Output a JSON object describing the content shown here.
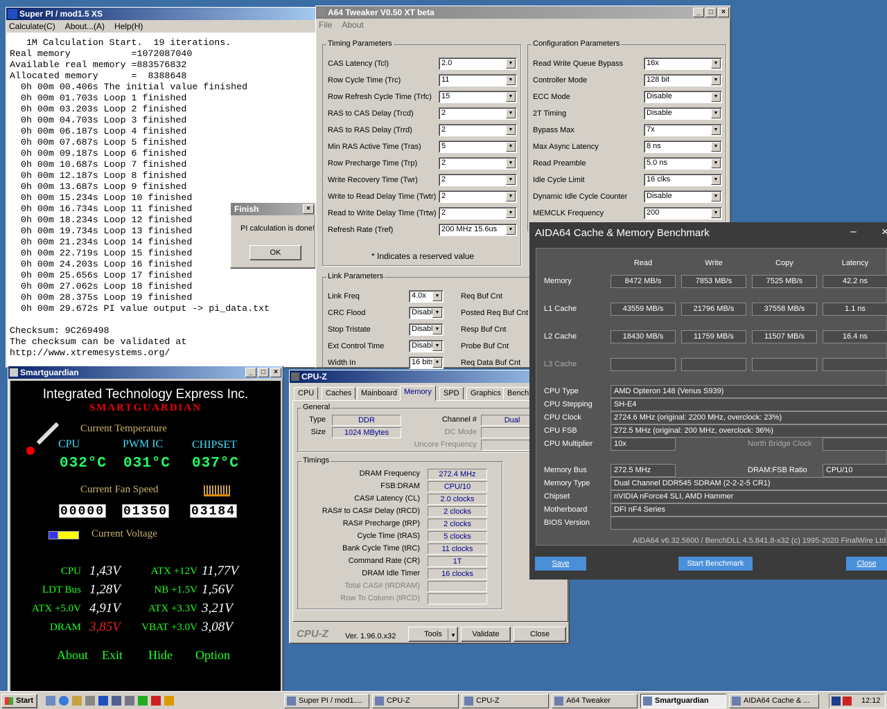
{
  "superpi": {
    "title": "Super PI / mod1.5 XS",
    "menu": [
      "Calculate(C)",
      "About...(A)",
      "Help(H)"
    ],
    "log": "   1M Calculation Start.  19 iterations.\nReal memory           =1072087040\nAvailable real memory =883576832\nAllocated memory      =  8388648\n  0h 00m 00.406s The initial value finished\n  0h 00m 01.703s Loop 1 finished\n  0h 00m 03.203s Loop 2 finished\n  0h 00m 04.703s Loop 3 finished\n  0h 00m 06.187s Loop 4 finished\n  0h 00m 07.687s Loop 5 finished\n  0h 00m 09.187s Loop 6 finished\n  0h 00m 10.687s Loop 7 finished\n  0h 00m 12.187s Loop 8 finished\n  0h 00m 13.687s Loop 9 finished\n  0h 00m 15.234s Loop 10 finished\n  0h 00m 16.734s Loop 11 finished\n  0h 00m 18.234s Loop 12 finished\n  0h 00m 19.734s Loop 13 finished\n  0h 00m 21.234s Loop 14 finished\n  0h 00m 22.719s Loop 15 finished\n  0h 00m 24.203s Loop 16 finished\n  0h 00m 25.656s Loop 17 finished\n  0h 00m 27.062s Loop 18 finished\n  0h 00m 28.375s Loop 19 finished\n  0h 00m 29.672s PI value output -> pi_data.txt\n\nChecksum: 9C269498\nThe checksum can be validated at\nhttp://www.xtremesystems.org/"
  },
  "finish": {
    "title": "Finish",
    "message": "PI calculation is done!",
    "ok": "OK"
  },
  "a64": {
    "title": "A64 Tweaker V0.50 XT beta",
    "menu": [
      "File",
      "About"
    ],
    "timing_title": "Timing Parameters",
    "timing": [
      {
        "label": "CAS Latency (Tcl)",
        "value": "2.0"
      },
      {
        "label": "Row Cycle Time (Trc)",
        "value": "11"
      },
      {
        "label": "Row Refresh Cycle Time (Trfc)",
        "value": "15"
      },
      {
        "label": "RAS to CAS Delay (Trcd)",
        "value": "2"
      },
      {
        "label": "RAS to RAS Delay (Trrd)",
        "value": "2"
      },
      {
        "label": "Min RAS Active Time (Tras)",
        "value": "5"
      },
      {
        "label": "Row Precharge Time (Trp)",
        "value": "2"
      },
      {
        "label": "Write Recovery Time (Twr)",
        "value": "2"
      },
      {
        "label": "Write to Read Delay Time (Twtr)",
        "value": "2"
      },
      {
        "label": "Read to Write Delay Time (Trtw)",
        "value": "2"
      },
      {
        "label": "Refresh Rate (Tref)",
        "value": "200 MHz 15.6us"
      }
    ],
    "reserved_note": "* Indicates a reserved value",
    "config_title": "Configuration Parameters",
    "config": [
      {
        "label": "Read Write Queue Bypass",
        "value": "16x"
      },
      {
        "label": "Controller Mode",
        "value": "128 bit"
      },
      {
        "label": "ECC Mode",
        "value": "Disable"
      },
      {
        "label": "2T Timing",
        "value": "Disable"
      },
      {
        "label": "Bypass Max",
        "value": "7x"
      },
      {
        "label": "Max Async Latency",
        "value": "8 ns"
      },
      {
        "label": "Read Preamble",
        "value": "5.0 ns"
      },
      {
        "label": "Idle Cycle Limit",
        "value": "16 clks"
      },
      {
        "label": "Dynamic Idle Cycle Counter",
        "value": "Disable"
      },
      {
        "label": "MEMCLK Frequency",
        "value": "200"
      }
    ],
    "link_title": "Link Parameters",
    "link": [
      {
        "label": "Link Freq",
        "value": "4.0x"
      },
      {
        "label": "CRC Flood",
        "value": "Disable"
      },
      {
        "label": "Stop Tristate",
        "value": "Disable"
      },
      {
        "label": "Ext Control Time",
        "value": "Disable"
      },
      {
        "label": "Width In",
        "value": "16 bits"
      }
    ],
    "buf": [
      "Req Buf Cnt",
      "Posted Req Buf Cnt",
      "Resp Buf Cnt",
      "Probe Buf Cnt",
      "Req Data Buf Cnt"
    ]
  },
  "aida": {
    "title": "AIDA64 Cache & Memory Benchmark",
    "cols": [
      "Read",
      "Write",
      "Copy",
      "Latency"
    ],
    "rows": [
      {
        "label": "Memory",
        "vals": [
          "8472 MB/s",
          "7853 MB/s",
          "7525 MB/s",
          "42.2 ns"
        ]
      },
      {
        "label": "L1 Cache",
        "vals": [
          "43559 MB/s",
          "21796 MB/s",
          "37558 MB/s",
          "1.1 ns"
        ]
      },
      {
        "label": "L2 Cache",
        "vals": [
          "18430 MB/s",
          "11759 MB/s",
          "11507 MB/s",
          "16.4 ns"
        ]
      },
      {
        "label": "L3 Cache",
        "vals": [
          "",
          "",
          "",
          ""
        ]
      }
    ],
    "cpu_type_l": "CPU Type",
    "cpu_type": "AMD Opteron 148  (Venus S939)",
    "cpu_step_l": "CPU Stepping",
    "cpu_step": "SH-E4",
    "cpu_clock_l": "CPU Clock",
    "cpu_clock": "2724.6 MHz  (original: 2200 MHz, overclock: 23%)",
    "cpu_fsb_l": "CPU FSB",
    "cpu_fsb": "272.5 MHz  (original: 200 MHz, overclock: 36%)",
    "cpu_mult_l": "CPU Multiplier",
    "cpu_mult": "10x",
    "nb_clock_l": "North Bridge Clock",
    "mem_bus_l": "Memory Bus",
    "mem_bus": "272.5 MHz",
    "dram_ratio_l": "DRAM:FSB Ratio",
    "dram_ratio": "CPU/10",
    "mem_type_l": "Memory Type",
    "mem_type": "Dual Channel DDR545 SDRAM  (2-2-2-5 CR1)",
    "chipset_l": "Chipset",
    "chipset": "nVIDIA nForce4 SLI, AMD Hammer",
    "mobo_l": "Motherboard",
    "mobo": "DFI nF4 Series",
    "bios_l": "BIOS Version",
    "footer": "AIDA64 v6.32.5600 / BenchDLL 4.5.841.8-x32  (c) 1995-2020 FinalWire Ltd.",
    "save": "Save",
    "start": "Start Benchmark",
    "close": "Close"
  },
  "cpuz": {
    "title": "CPU-Z",
    "tabs": [
      "CPU",
      "Caches",
      "Mainboard",
      "Memory",
      "SPD",
      "Graphics",
      "Bench"
    ],
    "general": "General",
    "type_l": "Type",
    "type": "DDR",
    "size_l": "Size",
    "size": "1024 MBytes",
    "channel_l": "Channel #",
    "channel": "Dual",
    "dc_mode": "DC Mode",
    "uncore": "Uncore Frequency",
    "timings": "Timings",
    "trows": [
      {
        "label": "DRAM Frequency",
        "value": "272.4 MHz"
      },
      {
        "label": "FSB:DRAM",
        "value": "CPU/10"
      },
      {
        "label": "CAS# Latency (CL)",
        "value": "2.0 clocks"
      },
      {
        "label": "RAS# to CAS# Delay (tRCD)",
        "value": "2 clocks"
      },
      {
        "label": "RAS# Precharge (tRP)",
        "value": "2 clocks"
      },
      {
        "label": "Cycle Time (tRAS)",
        "value": "5 clocks"
      },
      {
        "label": "Bank Cycle Time (tRC)",
        "value": "11 clocks"
      },
      {
        "label": "Command Rate (CR)",
        "value": "1T"
      },
      {
        "label": "DRAM Idle Timer",
        "value": "16 clocks"
      },
      {
        "label": "Total CAS# (tRDRAM)",
        "value": ""
      },
      {
        "label": "Row To Column (tRCD)",
        "value": ""
      }
    ],
    "brand": "CPU-Z",
    "ver": "Ver. 1.96.0.x32",
    "tools": "Tools",
    "validate": "Validate",
    "close": "Close"
  },
  "sg": {
    "title": "Smartguardian",
    "company": "Integrated Technology Express Inc.",
    "product": "SMARTGUARDIAN",
    "temp_title": "Current Temperature",
    "cpu": "CPU",
    "pwm": "PWM IC",
    "chipset": "CHIPSET",
    "t_cpu": "032°C",
    "t_pwm": "031°C",
    "t_chip": "037°C",
    "fan_title": "Current Fan Speed",
    "fans": [
      "00000",
      "01350",
      "03184"
    ],
    "volt_title": "Current Voltage",
    "volts": [
      {
        "label": "CPU",
        "value": "1,43V"
      },
      {
        "label": "ATX +12V",
        "value": "11,77V"
      },
      {
        "label": "LDT Bus",
        "value": "1,28V"
      },
      {
        "label": "NB +1.5V",
        "value": "1,56V"
      },
      {
        "label": "ATX +5.0V",
        "value": "4,91V"
      },
      {
        "label": "ATX +3.3V",
        "value": "3,21V"
      },
      {
        "label": "DRAM",
        "value": "3,85V"
      },
      {
        "label": "VBAT +3.0V",
        "value": "3,08V"
      }
    ],
    "about": "About",
    "exit": "Exit",
    "hide": "Hide",
    "option": "Option"
  },
  "taskbar": {
    "start": "Start",
    "items": [
      "Super PI / mod1....",
      "CPU-Z",
      "CPU-Z",
      "A64 Tweaker",
      "Smartguardian",
      "AIDA64 Cache & ..."
    ],
    "clock": "12:12"
  }
}
